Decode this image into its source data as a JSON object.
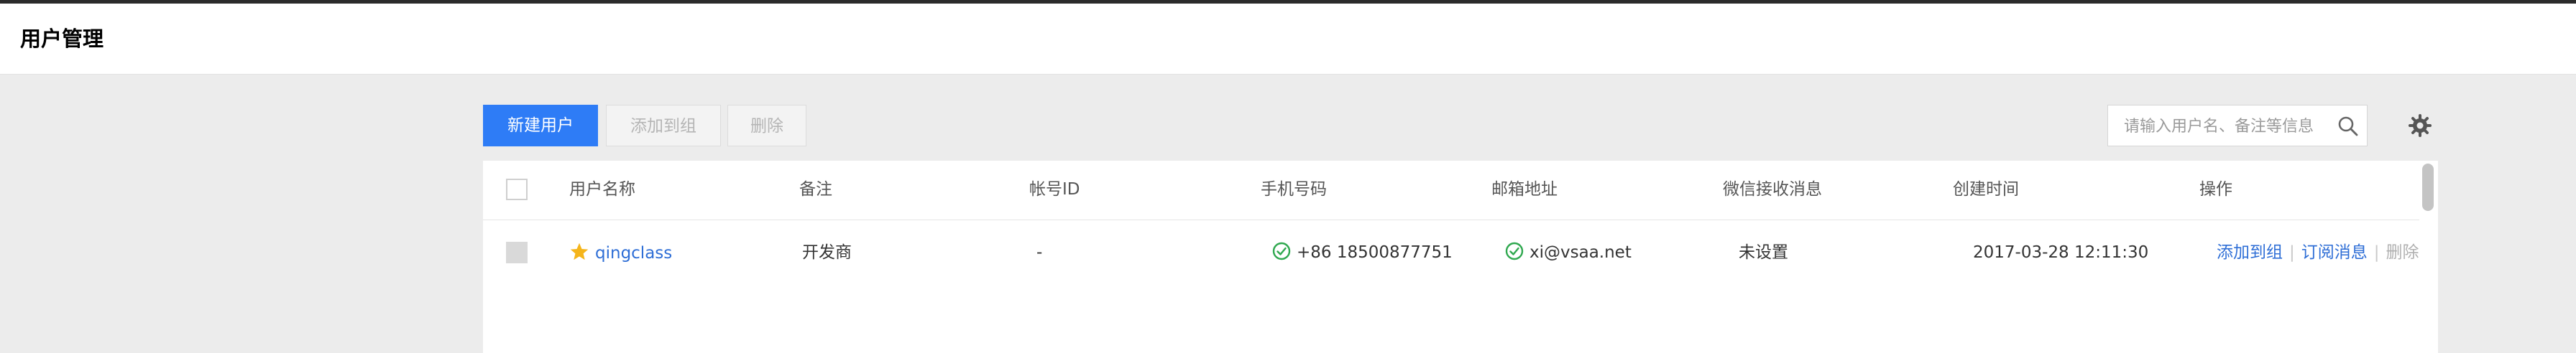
{
  "page": {
    "title": "用户管理"
  },
  "toolbar": {
    "new_user_label": "新建用户",
    "add_to_group_label": "添加到组",
    "delete_label": "删除"
  },
  "search": {
    "placeholder": "请输入用户名、备注等信息",
    "value": ""
  },
  "colors": {
    "primary": "#2e7cf6",
    "link": "#2e6ed6",
    "success": "#2fa84f",
    "star": "#f5b51b"
  },
  "table": {
    "headers": [
      "用户名称",
      "备注",
      "帐号ID",
      "手机号码",
      "邮箱地址",
      "微信接收消息",
      "创建时间",
      "操作"
    ],
    "rows": [
      {
        "username": "qingclass",
        "note": "开发商",
        "account_id": "-",
        "phone": "+86 18500877751",
        "email": "xi@vsaa.net",
        "wechat": "未设置",
        "created": "2017-03-28 12:11:30",
        "actions": [
          "添加到组",
          "订阅消息",
          "删除"
        ]
      }
    ]
  }
}
